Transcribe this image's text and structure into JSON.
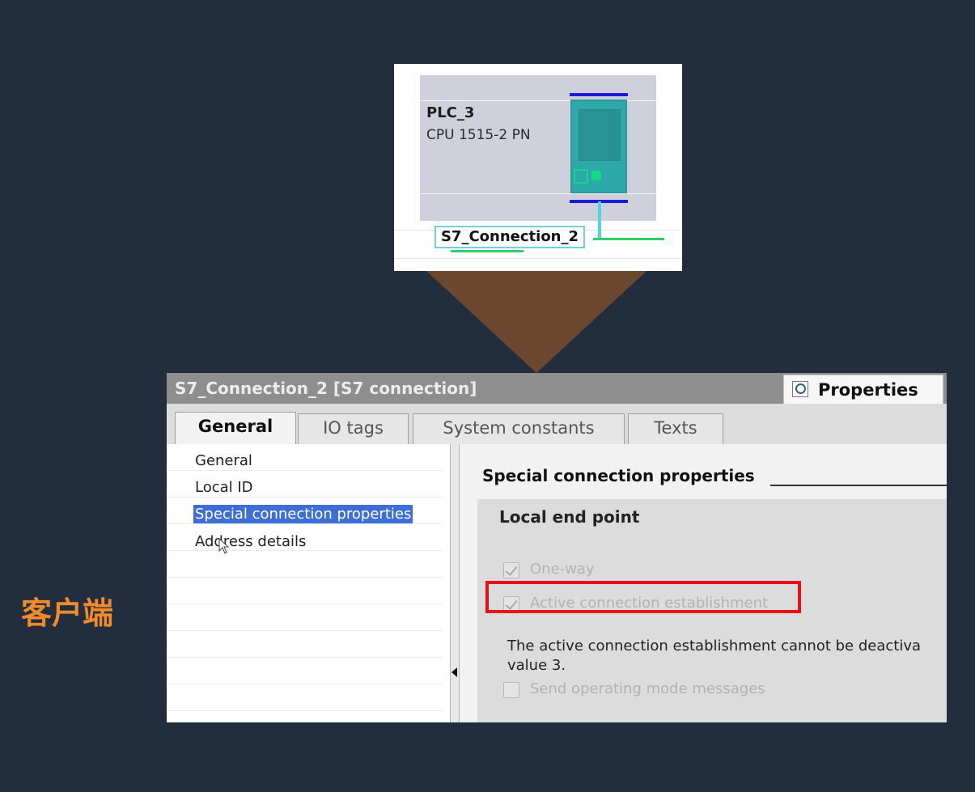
{
  "device_view": {
    "plc_name": "PLC_3",
    "cpu_type": "CPU 1515-2 PN",
    "connection_label": "S7_Connection_2"
  },
  "properties_window": {
    "title": "S7_Connection_2 [S7 connection]",
    "properties_tab_label": "Properties",
    "tabs": [
      "General",
      "IO tags",
      "System constants",
      "Texts"
    ],
    "active_tab": "General",
    "nav_items": [
      "General",
      "Local ID",
      "Special connection properties",
      "Address details"
    ],
    "selected_nav_item": "Special connection properties",
    "content": {
      "section_heading": "Special connection properties",
      "group_title": "Local end point",
      "checkboxes": [
        {
          "label": "One-way",
          "checked": true,
          "enabled": false
        },
        {
          "label": "Active connection establishment",
          "checked": true,
          "enabled": false,
          "highlighted": true
        },
        {
          "label": "Send operating mode messages",
          "checked": false,
          "enabled": false
        }
      ],
      "info_text": "The active connection establishment cannot be deactiva value 3."
    }
  },
  "side_caption": "客户端",
  "colors": {
    "background": "#222d3d",
    "callout": "#6b4730",
    "highlight": "#e80d18",
    "caption": "#ef8b2c",
    "selection": "#3d6fd6",
    "cpu_module": "#2ea8a8"
  }
}
